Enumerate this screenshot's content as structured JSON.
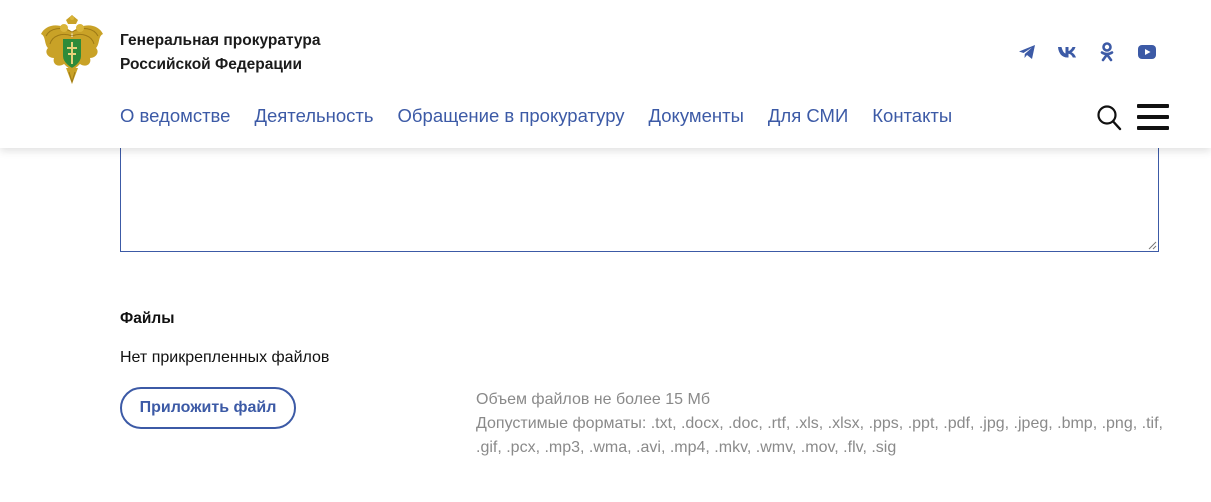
{
  "header": {
    "org_line1": "Генеральная прокуратура",
    "org_line2": "Российской Федерации",
    "social": [
      "telegram-icon",
      "vk-icon",
      "odnoklassniki-icon",
      "youtube-icon"
    ],
    "accent_color": "#3c5aa6"
  },
  "nav": {
    "items": [
      {
        "label": "О ведомстве"
      },
      {
        "label": "Деятельность"
      },
      {
        "label": "Обращение в прокуратуру"
      },
      {
        "label": "Документы"
      },
      {
        "label": "Для СМИ"
      },
      {
        "label": "Контакты"
      }
    ]
  },
  "form": {
    "message_value": "",
    "files_title": "Файлы",
    "no_files": "Нет прикрепленных файлов",
    "attach_label": "Приложить файл",
    "size_hint": "Объем файлов не более 15 Мб",
    "formats_hint": "Допустимые форматы: .txt, .docx, .doc, .rtf, .xls, .xlsx, .pps, .ppt, .pdf, .jpg, .jpeg, .bmp, .png, .tif, .gif, .pcx, .mp3, .wma, .avi, .mp4, .mkv, .wmv, .mov, .flv, .sig"
  }
}
